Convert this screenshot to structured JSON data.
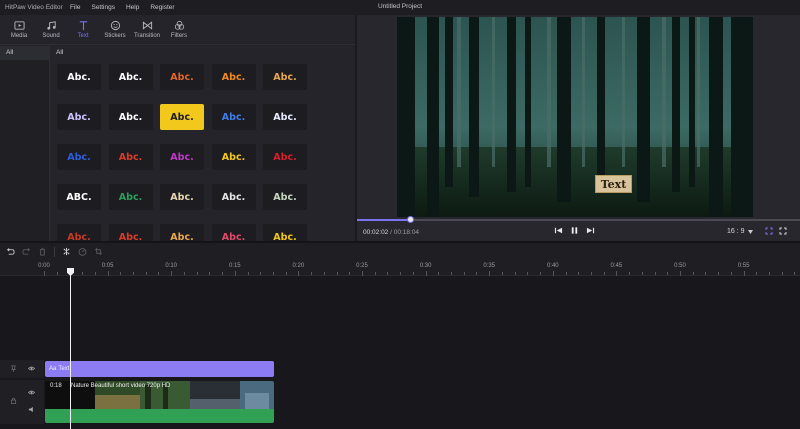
{
  "app": {
    "name": "HitPaw Video Editor",
    "project_title": "Untitled Project"
  },
  "menu": [
    "File",
    "Settings",
    "Help",
    "Register"
  ],
  "toolbar": {
    "tabs": [
      {
        "label": "Media",
        "icon": "media-icon"
      },
      {
        "label": "Sound",
        "icon": "music-note-icon"
      },
      {
        "label": "Text",
        "icon": "text-t-icon",
        "active": true
      },
      {
        "label": "Stickers",
        "icon": "smiley-icon"
      },
      {
        "label": "Transition",
        "icon": "bowtie-icon"
      },
      {
        "label": "Filters",
        "icon": "filter-circles-icon"
      }
    ]
  },
  "categories": {
    "sidebar_all": "All",
    "grid_title": "All"
  },
  "text_styles": [
    {
      "label": "Abc.",
      "color": "#ffffff",
      "bg": "#1c1c21"
    },
    {
      "label": "Abc.",
      "color": "#ffffff",
      "bg": "#1c1c21"
    },
    {
      "label": "Abc.",
      "color": "#e0662a",
      "bg": "#1c1c21"
    },
    {
      "label": "Abc.",
      "color": "#f08a20",
      "bg": "#1c1c21"
    },
    {
      "label": "Abc.",
      "color": "#e8a850",
      "bg": "#1c1c21"
    },
    {
      "label": "Abc.",
      "color": "#cfc3ff",
      "bg": "#1c1c21"
    },
    {
      "label": "Abc.",
      "color": "#ffffff",
      "bg": "#1c1c21"
    },
    {
      "label": "Abc.",
      "color": "#1c1c1c",
      "bg": "#f2c81c"
    },
    {
      "label": "Abc.",
      "color": "#3f7ee8",
      "bg": "#1c1c21"
    },
    {
      "label": "Abc.",
      "color": "#e8ecff",
      "bg": "#1c1c21"
    },
    {
      "label": "Abc.",
      "color": "#2b5fe0",
      "bg": "#1c1c21"
    },
    {
      "label": "Abc.",
      "color": "#e03a2a",
      "bg": "#1c1c21"
    },
    {
      "label": "Abc.",
      "color": "#c03ac8",
      "bg": "#1c1c21"
    },
    {
      "label": "Abc.",
      "color": "#f2c81c",
      "bg": "#1c1c21"
    },
    {
      "label": "Abc.",
      "color": "#d8202a",
      "bg": "#1c1c21"
    },
    {
      "label": "ABC.",
      "color": "#ffffff",
      "bg": "#1c1c21"
    },
    {
      "label": "Abc.",
      "color": "#2aa05a",
      "bg": "#1c1c21"
    },
    {
      "label": "Abc.",
      "color": "#e8d6b0",
      "bg": "#1c1c21"
    },
    {
      "label": "Abc.",
      "color": "#e4e4e4",
      "bg": "#1c1c21"
    },
    {
      "label": "Abc.",
      "color": "#c8d8c0",
      "bg": "#1c1c21"
    },
    {
      "label": "Abc.",
      "color": "#c83a20",
      "bg": "#1c1c21"
    },
    {
      "label": "Abc.",
      "color": "#e03a2a",
      "bg": "#1c1c21"
    },
    {
      "label": "Abc.",
      "color": "#e8a850",
      "bg": "#1c1c21"
    },
    {
      "label": "Abc.",
      "color": "#e04a6a",
      "bg": "#1c1c21"
    },
    {
      "label": "Abc.",
      "color": "#f2c81c",
      "bg": "#1c1c21"
    }
  ],
  "preview": {
    "overlay_text": "Text",
    "current_time": "00:02:02",
    "separator": "/",
    "total_time": "00:18:04",
    "progress": 0.12,
    "aspect_ratio": "16 : 9"
  },
  "timeline": {
    "ruler_labels": [
      "0:00",
      "0:05",
      "0:10",
      "0:15",
      "0:20",
      "0:25",
      "0:30",
      "0:35",
      "0:40",
      "0:45",
      "0:50",
      "0:55"
    ],
    "text_clip_label": "Text",
    "video_clip": {
      "duration": "0:18",
      "name": "Nature Beautiful short video 720p HD"
    }
  },
  "colors": {
    "accent": "#7b72f2",
    "text_clip": "#8b7cf4",
    "audio": "#2fa054"
  }
}
